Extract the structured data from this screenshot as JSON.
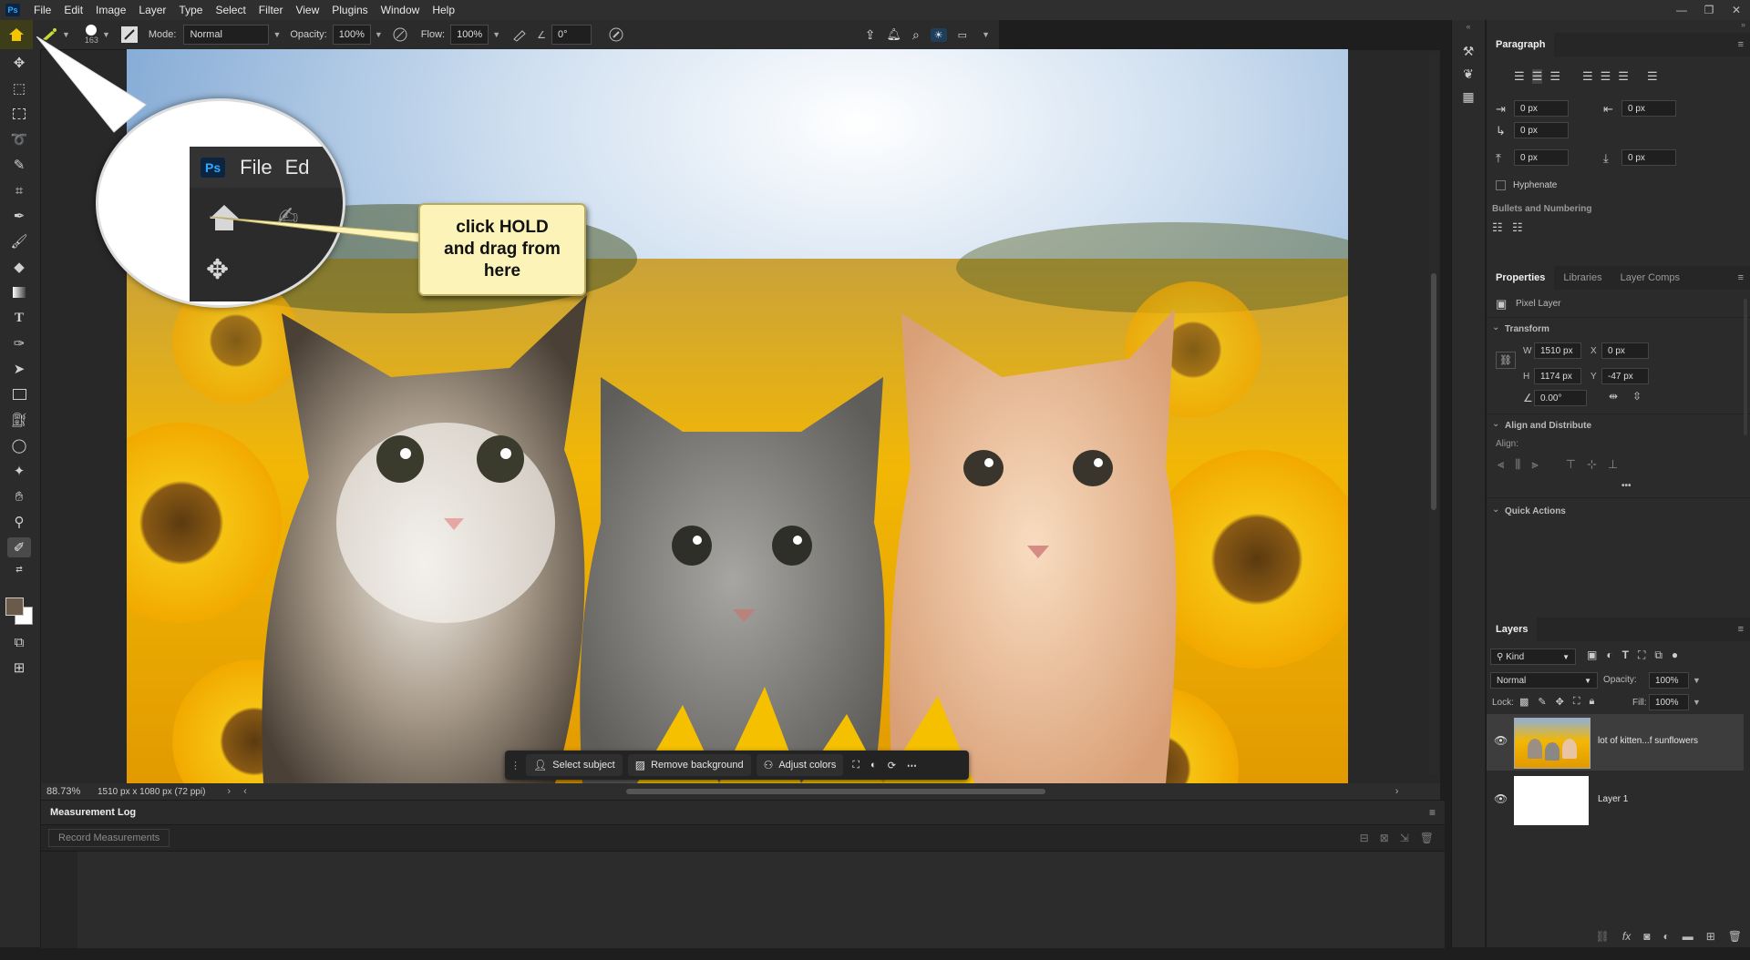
{
  "menu": {
    "logo": "Ps",
    "items": [
      "File",
      "Edit",
      "Image",
      "Layer",
      "Type",
      "Select",
      "Filter",
      "View",
      "Plugins",
      "Window",
      "Help"
    ]
  },
  "options_bar": {
    "brush_size": "163",
    "mode_label": "Mode:",
    "mode_value": "Normal",
    "opacity_label": "Opacity:",
    "opacity_value": "100%",
    "flow_label": "Flow:",
    "flow_value": "100%",
    "angle_value": "0°"
  },
  "callout": {
    "line1": "click HOLD",
    "line2": "and drag from",
    "line3": "here"
  },
  "zoom_inset": {
    "logo": "Ps",
    "menu_file": "File",
    "menu_edit_partial": "Ed"
  },
  "context_bar": {
    "select_subject": "Select subject",
    "remove_background": "Remove background",
    "adjust_colors": "Adjust colors"
  },
  "status_bar": {
    "zoom": "88.73%",
    "doc_info": "1510 px x 1080 px (72 ppi)"
  },
  "measurement_log": {
    "title": "Measurement Log",
    "record_button": "Record Measurements"
  },
  "paragraph_panel": {
    "title": "Paragraph",
    "indent_left": "0 px",
    "indent_right": "0 px",
    "indent_first": "0 px",
    "space_before": "0 px",
    "space_after": "0 px",
    "hyphenate": "Hyphenate",
    "bullets": "Bullets and Numbering"
  },
  "properties_panel": {
    "tabs": [
      "Properties",
      "Libraries",
      "Layer Comps"
    ],
    "layer_type": "Pixel Layer",
    "transform_title": "Transform",
    "w_label": "W",
    "w_value": "1510 px",
    "h_label": "H",
    "h_value": "1174 px",
    "x_label": "X",
    "x_value": "0 px",
    "y_label": "Y",
    "y_value": "-47 px",
    "angle_value": "0.00°",
    "align_title": "Align and Distribute",
    "align_label": "Align:",
    "more": "•••",
    "quick_actions": "Quick Actions"
  },
  "layers_panel": {
    "title": "Layers",
    "filter_kind": "Kind",
    "blend_mode": "Normal",
    "opacity_label": "Opacity:",
    "opacity_value": "100%",
    "lock_label": "Lock:",
    "fill_label": "Fill:",
    "fill_value": "100%",
    "layers": [
      {
        "name": "lot of kitten...f sunflowers",
        "selected": true
      },
      {
        "name": "Layer 1",
        "selected": false
      }
    ]
  },
  "colors": {
    "accent": "#31a8ff",
    "callout_bg": "#fbf3b8",
    "sunflower": "#f2b705",
    "panel_bg": "#2b2b2b",
    "selected_layer": "#3d3d3d"
  }
}
